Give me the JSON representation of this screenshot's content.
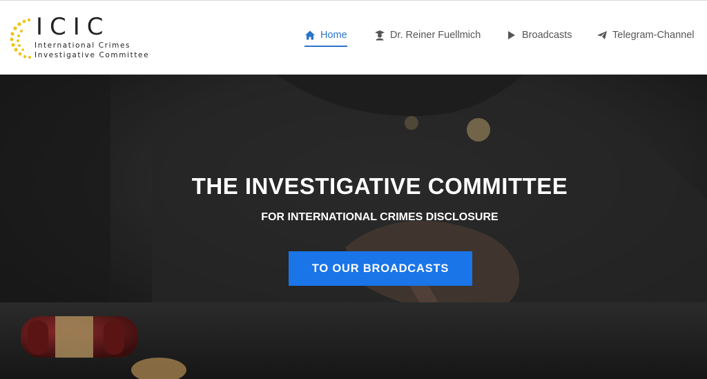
{
  "brand": {
    "letters": "ICIC",
    "line1": "International Crimes",
    "line2": "Investigative Committee",
    "sun_color": "#f0c419"
  },
  "nav": {
    "items": [
      {
        "label": "Home",
        "icon": "home-icon",
        "active": true
      },
      {
        "label": "Dr. Reiner Fuellmich",
        "icon": "graduate-icon",
        "active": false
      },
      {
        "label": "Broadcasts",
        "icon": "play-icon",
        "active": false
      },
      {
        "label": "Telegram-Channel",
        "icon": "paper-plane-icon",
        "active": false
      }
    ],
    "active_color": "#2a73c9"
  },
  "hero": {
    "title": "THE INVESTIGATIVE COMMITTEE",
    "subtitle": "FOR INTERNATIONAL CRIMES DISCLOSURE",
    "cta_label": "TO OUR BROADCASTS",
    "cta_color": "#1a75e8"
  }
}
